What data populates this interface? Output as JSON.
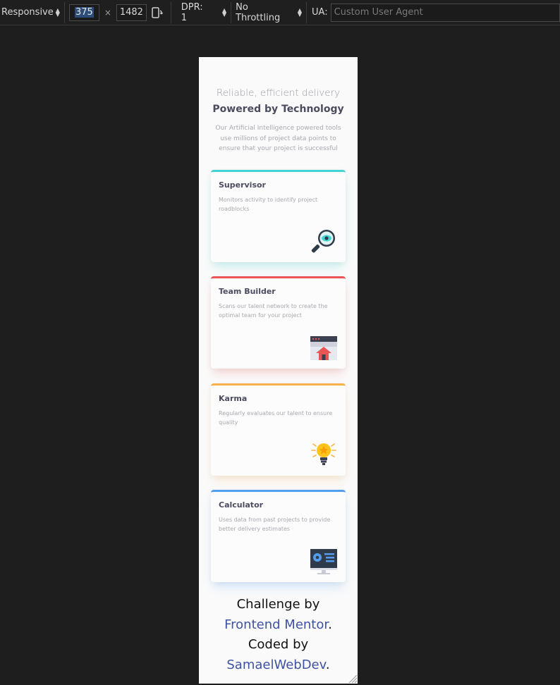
{
  "toolbar": {
    "device": "Responsive",
    "width": "375",
    "times": "×",
    "height": "1482",
    "dpr": "DPR: 1",
    "throttling": "No Throttling",
    "ua_label": "UA:",
    "ua_placeholder": "Custom User Agent"
  },
  "page": {
    "kicker": "Reliable, efficient delivery",
    "headline": "Powered by Technology",
    "description": "Our Artificial Intelligence powered tools use millions of project data points to ensure that your project is successful",
    "cards": [
      {
        "title": "Supervisor",
        "text": "Monitors activity to identify project roadblocks",
        "accent": "#45d3d3",
        "icon": "supervisor-icon"
      },
      {
        "title": "Team Builder",
        "text": "Scans our talent network to create the optimal team for your project",
        "accent": "#ea5454",
        "icon": "team-builder-icon"
      },
      {
        "title": "Karma",
        "text": "Regularly evaluates our talent to ensure quality",
        "accent": "#fcaf4a",
        "icon": "karma-icon"
      },
      {
        "title": "Calculator",
        "text": "Uses data from past projects to provide better delivery estimates",
        "accent": "#549ef2",
        "icon": "calculator-icon"
      }
    ],
    "attribution": {
      "prefix": "Challenge by",
      "mentor_link": "Frontend Mentor",
      "middle": "Coded by",
      "author_link": "SamaelWebDev",
      "period": "."
    }
  }
}
